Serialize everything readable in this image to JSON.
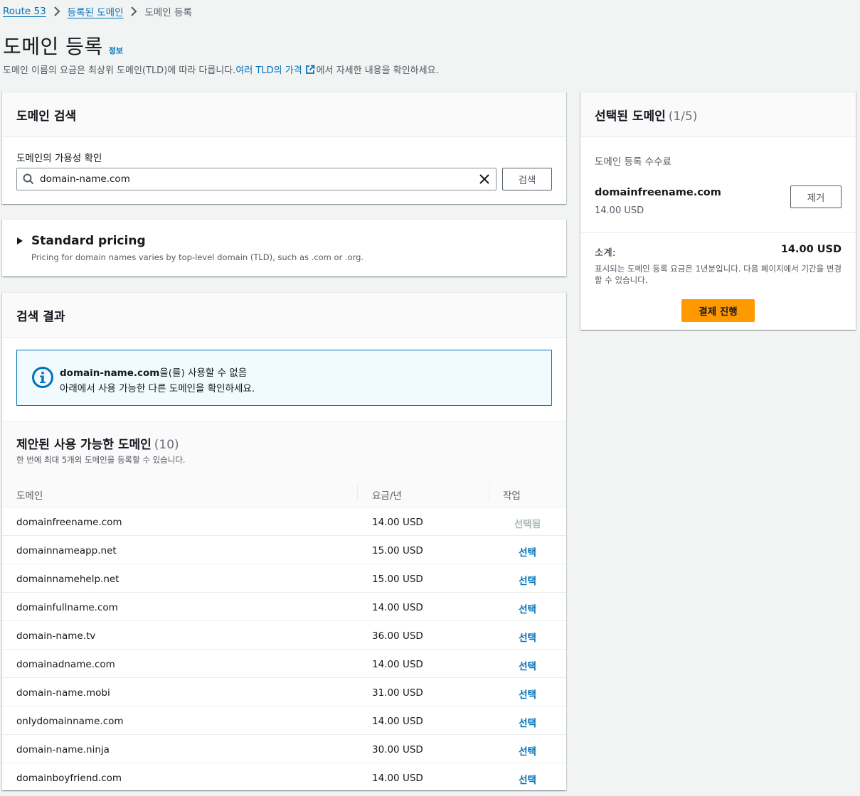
{
  "breadcrumb": {
    "items": [
      "Route 53",
      "등록된 도메인"
    ],
    "current": "도메인 등록"
  },
  "header": {
    "title": "도메인 등록",
    "info_link": "정보",
    "desc_prefix": "도메인 이름의 요금은 최상위 도메인(TLD)에 따라 다릅니다. ",
    "desc_link": "여러 TLD의 가격",
    "desc_suffix": "에서 자세한 내용을 확인하세요."
  },
  "search_panel": {
    "title": "도메인 검색",
    "field_label": "도메인의 가용성 확인",
    "input_value": "domain-name.com",
    "button_label": "검색"
  },
  "pricing_panel": {
    "title": "Standard pricing",
    "description": "Pricing for domain names varies by top-level domain (TLD), such as .com or .org."
  },
  "results_panel": {
    "title": "검색 결과",
    "alert": {
      "title_domain": "domain-name.com",
      "title_suffix": "을(를) 사용할 수 없음",
      "body": "아래에서 사용 가능한 다른 도메인을 확인하세요."
    },
    "table": {
      "title": "제안된 사용 가능한 도메인",
      "count": "(10)",
      "subtitle": "한 번에 최대 5개의 도메인을 등록할 수 있습니다.",
      "columns": [
        "도메인",
        "요금/년",
        "작업"
      ],
      "rows": [
        {
          "domain": "domainfreename.com",
          "price": "14.00 USD",
          "action": "선택됨",
          "disabled": true
        },
        {
          "domain": "domainnameapp.net",
          "price": "15.00 USD",
          "action": "선택",
          "disabled": false
        },
        {
          "domain": "domainnamehelp.net",
          "price": "15.00 USD",
          "action": "선택",
          "disabled": false
        },
        {
          "domain": "domainfullname.com",
          "price": "14.00 USD",
          "action": "선택",
          "disabled": false
        },
        {
          "domain": "domain-name.tv",
          "price": "36.00 USD",
          "action": "선택",
          "disabled": false
        },
        {
          "domain": "domainadname.com",
          "price": "14.00 USD",
          "action": "선택",
          "disabled": false
        },
        {
          "domain": "domain-name.mobi",
          "price": "31.00 USD",
          "action": "선택",
          "disabled": false
        },
        {
          "domain": "onlydomainname.com",
          "price": "14.00 USD",
          "action": "선택",
          "disabled": false
        },
        {
          "domain": "domain-name.ninja",
          "price": "30.00 USD",
          "action": "선택",
          "disabled": false
        },
        {
          "domain": "domainboyfriend.com",
          "price": "14.00 USD",
          "action": "선택",
          "disabled": false
        }
      ]
    }
  },
  "selected_panel": {
    "title": "선택된 도메인",
    "count": "(1/5)",
    "fee_label": "도메인 등록 수수료",
    "domain": "domainfreename.com",
    "price": "14.00 USD",
    "remove_label": "제거",
    "subtotal_label": "소계:",
    "subtotal_value": "14.00 USD",
    "note": "표시되는 도메인 등록 요금은 1년분입니다. 다음 페이지에서 기간을 변경할 수 있습니다.",
    "checkout_label": "결제 진행"
  },
  "colors": {
    "link": "#0073bb",
    "primary_button": "#ff9900",
    "disabled_text": "#aab7b8",
    "alert_border": "#0073bb",
    "alert_bg": "#f1faff"
  }
}
